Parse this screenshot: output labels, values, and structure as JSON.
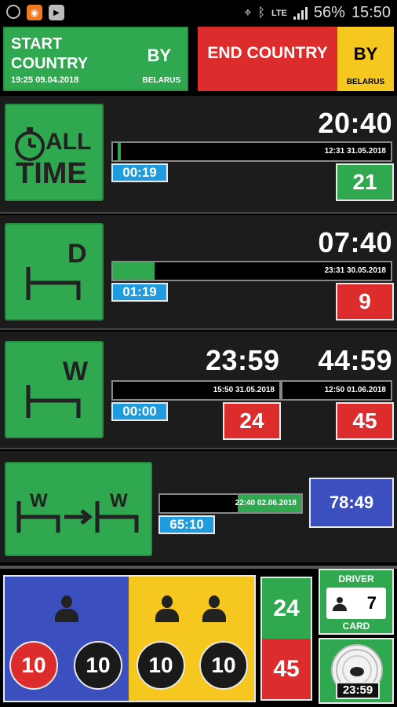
{
  "status_bar": {
    "icons": [
      "settings-icon",
      "app-icon",
      "youtube-icon",
      "location-icon",
      "bluetooth-icon",
      "lte-icon",
      "signal-icon"
    ],
    "network": "LTE",
    "battery": "56%",
    "time": "15:50"
  },
  "start_country": {
    "title": "START COUNTRY",
    "code": "BY",
    "name": "BELARUS",
    "datetime": "19:25 09.04.2018"
  },
  "end_country": {
    "title": "END COUNTRY",
    "code": "BY",
    "name": "BELARUS"
  },
  "all_time": {
    "icon_label_1": "ALL",
    "icon_label_2": "TIME",
    "big_time": "20:40",
    "bar_label": "12:31 31.05.2018",
    "bar_fill": 0.01,
    "elapsed": "00:19",
    "count": "21"
  },
  "daily_rest": {
    "icon_letter": "D",
    "big_time": "07:40",
    "bar_label": "23:31 30.05.2018",
    "bar_fill": 0.15,
    "elapsed": "01:19",
    "count": "9"
  },
  "weekly_rest": {
    "icon_letter": "W",
    "big_time_1": "23:59",
    "big_time_2": "44:59",
    "bar_label_1": "15:50 31.05.2018",
    "bar_label_2": "12:50 01.06.2018",
    "elapsed": "00:00",
    "count_1": "24",
    "count_2": "45"
  },
  "weekly_transition": {
    "icon_letter": "W",
    "bar_label": "22:40 02.06.2018",
    "bar_fill": 0.45,
    "elapsed": "65:10",
    "total": "78:49"
  },
  "drivers": {
    "blue_counts": [
      "10",
      "10"
    ],
    "yellow_counts": [
      "10",
      "10"
    ]
  },
  "summary": {
    "top": "24",
    "bottom": "45"
  },
  "driver_card": {
    "title": "DRIVER",
    "subtitle": "CARD",
    "number": "7"
  },
  "disc": {
    "time": "23:59"
  },
  "colors": {
    "green": "#2fa84f",
    "red": "#dd2c2c",
    "yellow": "#f6c71f",
    "blue": "#3b4fbf",
    "light_blue": "#1f9be0"
  }
}
